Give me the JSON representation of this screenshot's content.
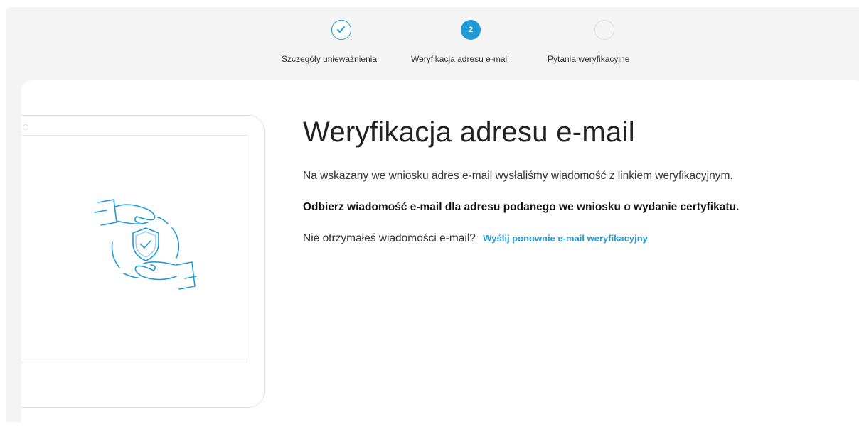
{
  "stepper": {
    "steps": [
      {
        "label": "Szczegóły unieważnienia",
        "state": "done",
        "icon": "check-icon"
      },
      {
        "label": "Weryfikacja adresu e-mail",
        "state": "active",
        "number": "2"
      },
      {
        "label": "Pytania weryfikacyjne",
        "state": "todo"
      }
    ]
  },
  "main": {
    "title": "Weryfikacja adresu e-mail",
    "info": "Na wskazany we wniosku adres e-mail wysłaliśmy wiadomość z linkiem weryfikacyjnym.",
    "instruction": "Odbierz wiadomość e-mail dla adresu podanego we wniosku o wydanie certyfikatu.",
    "resend_prompt": "Nie otrzymałeś wiadomości e-mail?",
    "resend_link": "Wyślij ponownie e-mail weryfikacyjny"
  },
  "illustration": {
    "icon": "hands-shield-check-icon"
  },
  "colors": {
    "accent": "#1e9ad6",
    "background": "#f4f4f4",
    "card": "#ffffff"
  }
}
